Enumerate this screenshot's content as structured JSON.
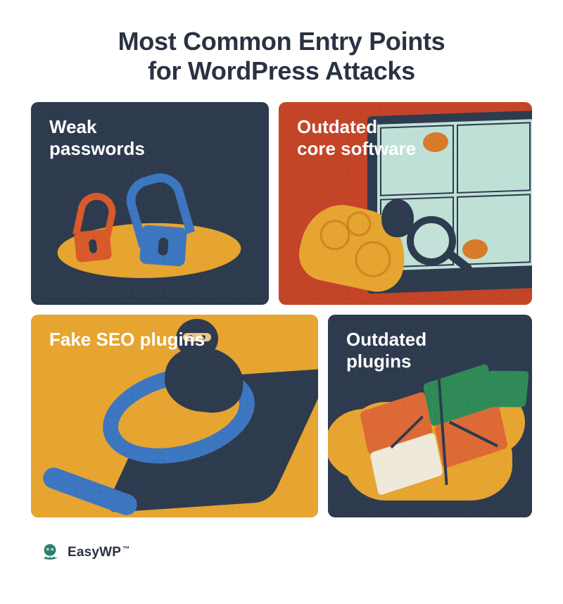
{
  "title_line1": "Most Common Entry Points",
  "title_line2": "for WordPress Attacks",
  "tiles": {
    "weak_passwords": {
      "label": "Weak\npasswords",
      "illustration": "open-padlocks",
      "bg": "navy"
    },
    "outdated_core": {
      "label": "Outdated\ncore software",
      "illustration": "person-magnifier-bugs",
      "bg": "orange"
    },
    "fake_seo_plugins": {
      "label": "Fake SEO plugins",
      "illustration": "ninja-on-magnifier",
      "bg": "mustard"
    },
    "outdated_plugins": {
      "label": "Outdated\nplugins",
      "illustration": "broken-puzzle",
      "bg": "navy"
    }
  },
  "brand": {
    "name": "EasyWP",
    "trademark": "™",
    "logo": "octopus-icon"
  },
  "palette": {
    "navy": "#2e3b4e",
    "orange_red": "#c44428",
    "mustard": "#e6a431",
    "blue": "#3d76c0",
    "cream": "#f6f2e7"
  }
}
